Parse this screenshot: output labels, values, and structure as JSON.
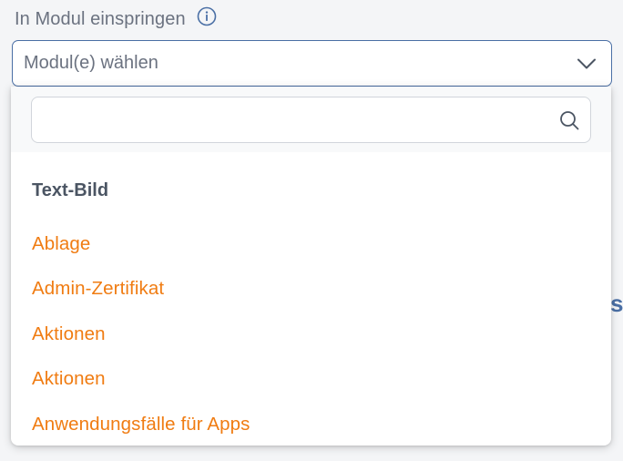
{
  "field": {
    "label": "In Modul einspringen",
    "info_icon": "info-icon",
    "placeholder": "Modul(e) wählen",
    "chevron_icon": "chevron-down-icon"
  },
  "background_text": "sc",
  "dropdown": {
    "search": {
      "value": "",
      "icon": "search-icon"
    },
    "group_header": "Text-Bild",
    "options": [
      {
        "label": "Ablage"
      },
      {
        "label": "Admin-Zertifikat"
      },
      {
        "label": "Aktionen"
      },
      {
        "label": "Aktionen"
      },
      {
        "label": "Anwendungsfälle für Apps"
      }
    ]
  },
  "colors": {
    "accent_orange": "#f07c12",
    "border_blue": "#4a6fa5",
    "muted_text": "#6b7280"
  }
}
